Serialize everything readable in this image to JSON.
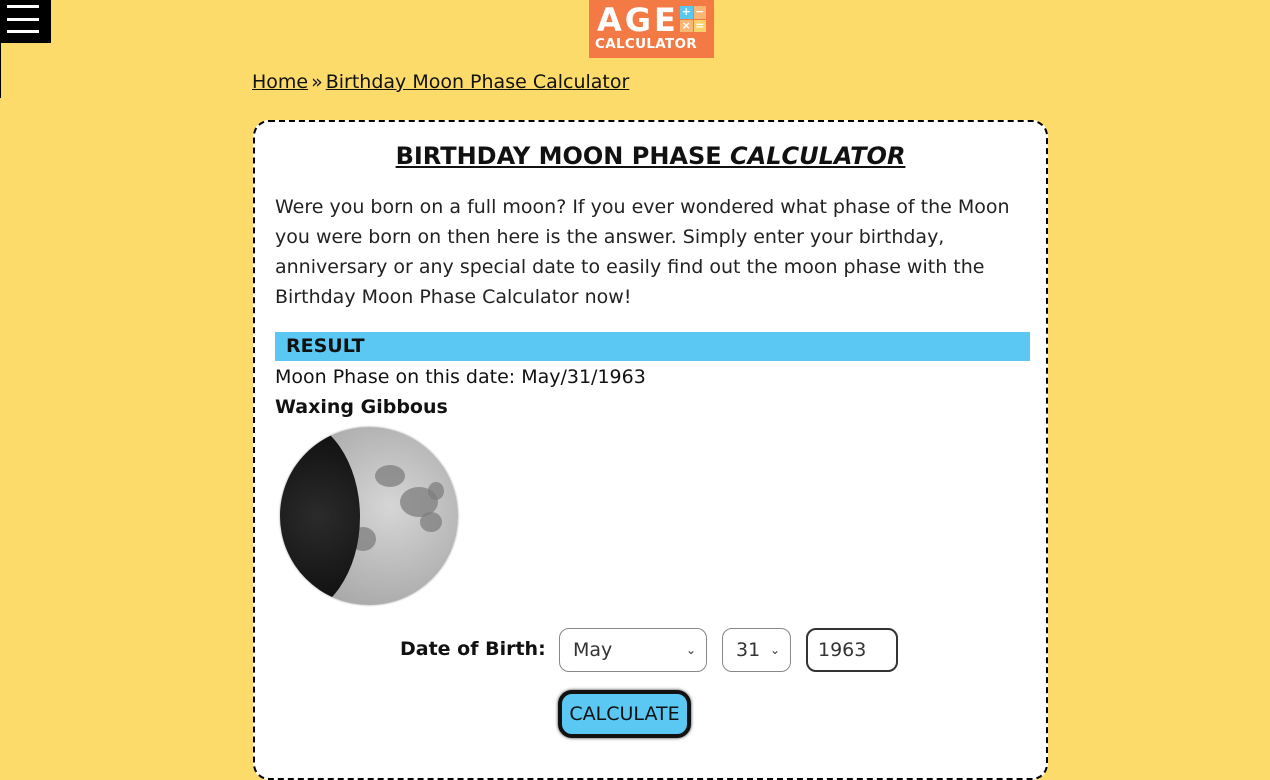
{
  "header": {
    "menu_icon": "hamburger-menu-icon",
    "logo": {
      "line1": "AGE",
      "line2": "CALCULATOR",
      "ops": [
        "+",
        "−",
        "×",
        "="
      ]
    }
  },
  "breadcrumb": {
    "home": "Home",
    "separator": "»",
    "current": "Birthday Moon Phase Calculator"
  },
  "card": {
    "title_main": "BIRTHDAY MOON PHASE ",
    "title_em": "CALCULATOR",
    "intro": "Were you born on a full moon? If you ever wondered what phase of the Moon you were born on then here is the answer. Simply enter your birthday, anniversary or any special date to easily find out the moon phase with the Birthday Moon Phase Calculator now!",
    "result": {
      "heading": "RESULT",
      "line": "Moon Phase on this date: May/31/1963",
      "phase": "Waxing Gibbous",
      "image": "waxing-gibbous-moon"
    },
    "form": {
      "dob_label": "Date of Birth:",
      "month": "May",
      "day": "31",
      "year": "1963",
      "chevron": "⌄",
      "calculate_label": "CALCULATE"
    }
  },
  "colors": {
    "background": "#fcdb6a",
    "accent": "#5ac8f3",
    "logo": "#f47a45"
  }
}
